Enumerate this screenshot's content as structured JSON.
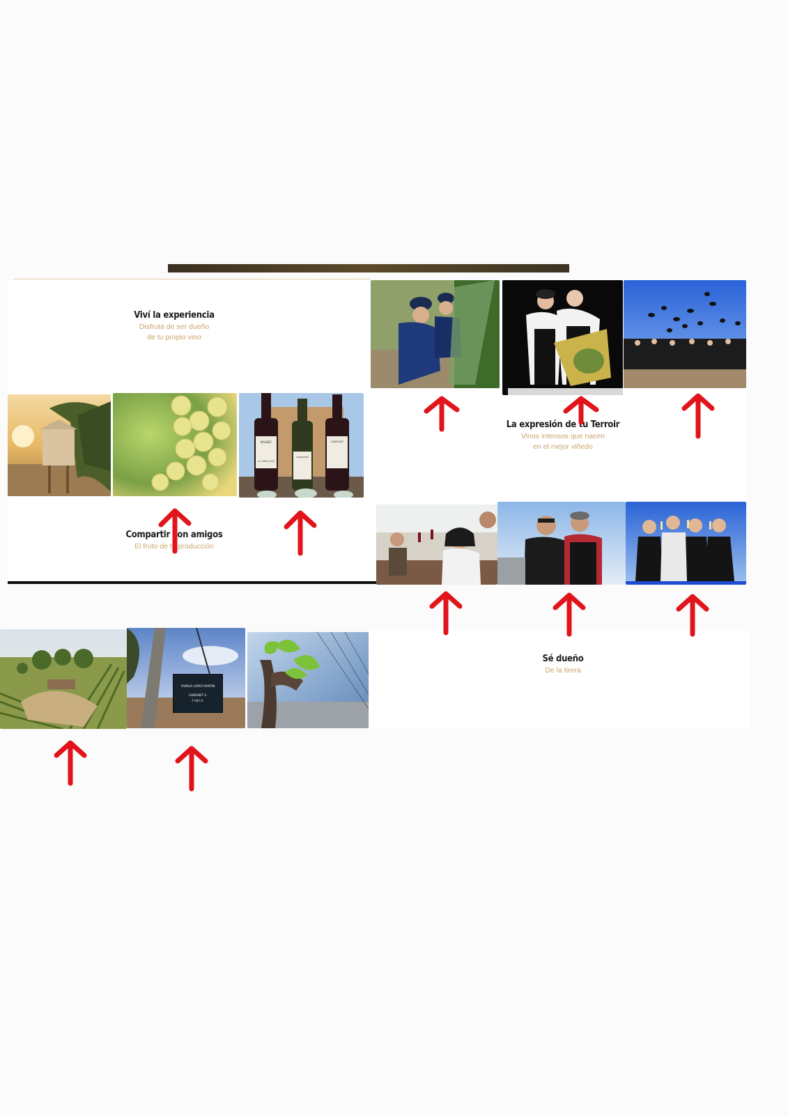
{
  "sections": {
    "experiencia": {
      "title": "Viví la experiencia",
      "subtitle_line1": "Disfrutá de ser dueño",
      "subtitle_line2": "de tu propio vino"
    },
    "compartir": {
      "title": "Compartir con amigos",
      "subtitle": "El fruto de tu producción"
    },
    "terroir": {
      "title": "La expresión de tu Terroir",
      "subtitle_line1": "Vinos intensos que nacen",
      "subtitle_line2": "en el mejor viñedo"
    },
    "dueno": {
      "title": "Sé dueño",
      "subtitle": "De la tierra"
    }
  },
  "wine_labels": [
    "MALBEC",
    "TORRONTÉS",
    "CABERNET"
  ],
  "winery_label": "LA ARBOLEDA",
  "vine_sign": {
    "line1": "FAMILIA LOPEZ MARTIN",
    "line2": "CABERNET S.",
    "line3": "FINCA"
  },
  "colors": {
    "accent_gold": "#c9a46a",
    "arrow_red": "#e1141c",
    "heading": "#1c1c1c"
  }
}
